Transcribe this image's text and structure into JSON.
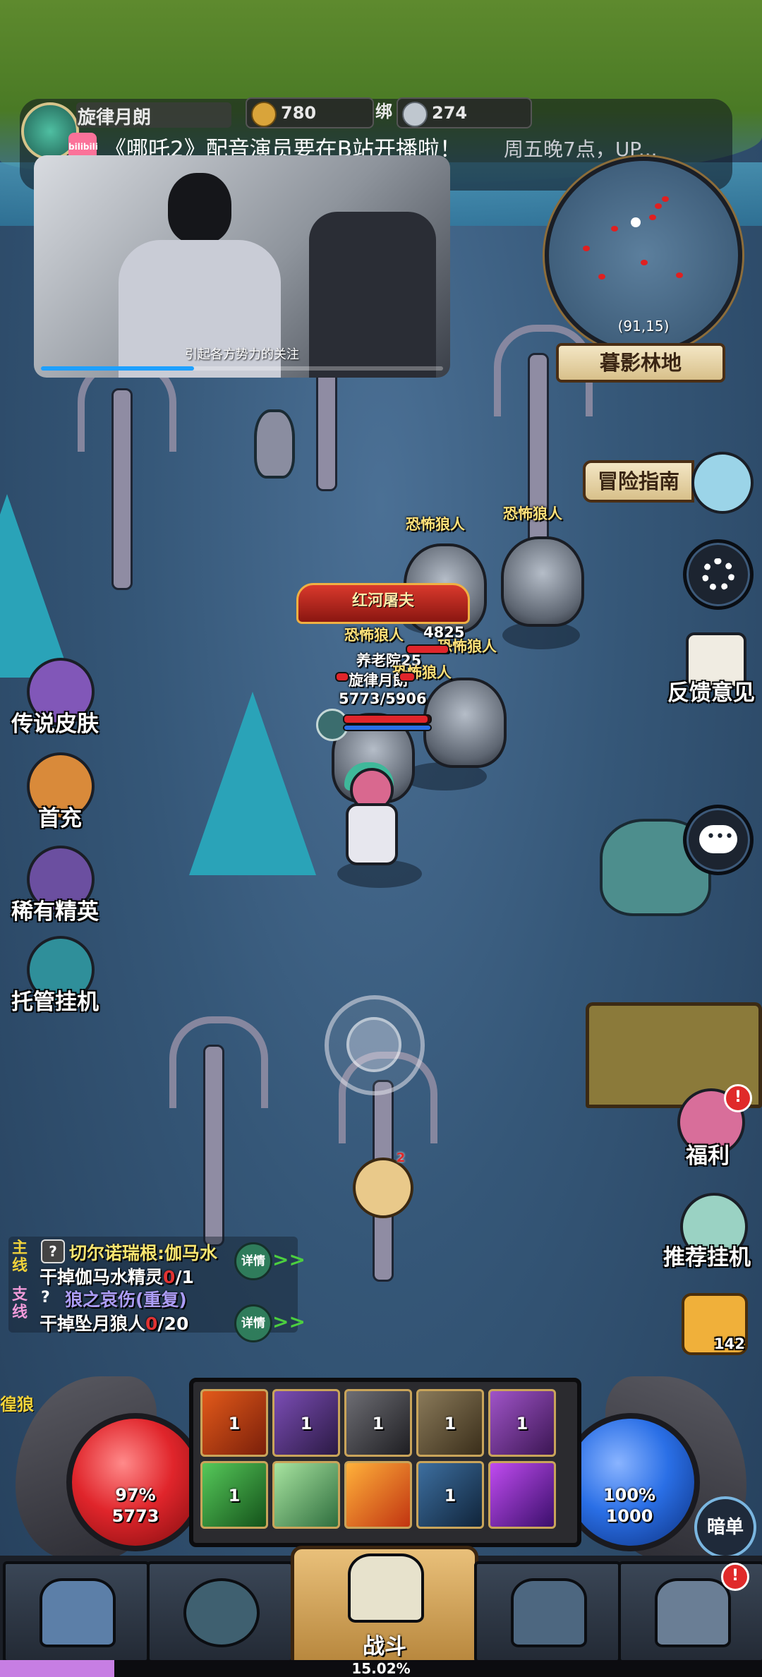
{
  "player": {
    "name": "旋律月朗",
    "gold": "780",
    "bound_label": "绑",
    "bound_value": "274"
  },
  "notice": {
    "text": "《哪吒2》配音演员要在B站开播啦！",
    "subtext": "周五晚7点，UP...",
    "app_icon": "bilibili-icon"
  },
  "video": {
    "subtitle": "引起各方势力的关注",
    "progress_fraction": 0.38
  },
  "minimap": {
    "coords": "(91,15)",
    "zone": "暮影林地"
  },
  "right_menu": {
    "guide": "冒险指南",
    "feedback": "反馈意见",
    "welfare": "福利",
    "recommend": "推荐挂机",
    "item_count": "142"
  },
  "left_menu": {
    "skins": "传说皮肤",
    "first_charge": "首充",
    "rare_elite": "稀有精英",
    "auto": "托管挂机"
  },
  "world": {
    "boss_title": "红河屠夫",
    "enemy_names": [
      "恐怖狼人",
      "恐怖狼人",
      "恐怖狼人",
      "恐怖狼人",
      "恐怖狼人"
    ],
    "overlap_hp_1": "4825",
    "overlap_line_2": "养老院25",
    "player_name": "旋律月朗",
    "player_hp": "5773/5906",
    "edge_text": "徨狼",
    "pet_badge": "2"
  },
  "quests": {
    "main_tag": "主线",
    "main_title": "切尔诺瑞根:伽马水",
    "main_task": "干掉伽马水精灵",
    "main_progress": "0",
    "main_total": "/1",
    "side_tag": "支线",
    "side_title": "狼之哀伤(重复)",
    "side_task": "干掉坠月狼人",
    "side_progress": "0",
    "side_total": "/20",
    "detail": "详情",
    "arrows": ">>"
  },
  "hud": {
    "hp_percent": "97%",
    "hp_value": "5773",
    "mp_percent": "100%",
    "mp_value": "1000",
    "dark_button": "暗单",
    "skills_row1": [
      "1",
      "1",
      "1",
      "1",
      "1"
    ],
    "skills_row2": [
      "1",
      "",
      "",
      "1",
      ""
    ],
    "fight": "战斗",
    "exp": "15.02%",
    "exp_fraction": 0.1502,
    "nav_alert": "!"
  },
  "colors": {
    "hp": "#e0252b",
    "mp": "#2a6fe6",
    "gold": "#d9a43a",
    "exp": "#c77ee3"
  }
}
